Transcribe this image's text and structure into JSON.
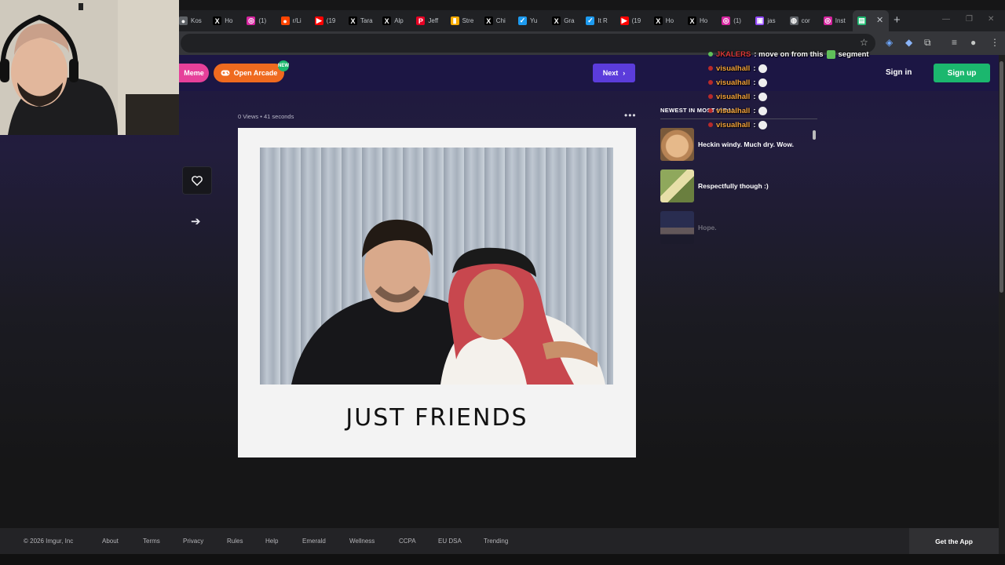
{
  "browser": {
    "tabs": [
      {
        "label": "Kos",
        "icon": "generic-site-icon",
        "color": "#5f6368"
      },
      {
        "label": "Ho",
        "icon": "x-icon",
        "color": "#000000"
      },
      {
        "label": "(1)",
        "icon": "instagram-icon",
        "color": "#d6249f"
      },
      {
        "label": "r/Li",
        "icon": "reddit-icon",
        "color": "#ff4500"
      },
      {
        "label": "(19",
        "icon": "youtube-icon",
        "color": "#ff0000"
      },
      {
        "label": "Tara",
        "icon": "x-icon",
        "color": "#000000"
      },
      {
        "label": "Alp",
        "icon": "x-icon",
        "color": "#000000"
      },
      {
        "label": "Jeff",
        "icon": "pin-icon",
        "color": "#e60023"
      },
      {
        "label": "Stre",
        "icon": "chart-icon",
        "color": "#f9ab00"
      },
      {
        "label": "Chi",
        "icon": "x-icon",
        "color": "#000000"
      },
      {
        "label": "Yu",
        "icon": "check-icon",
        "color": "#1d9bf0"
      },
      {
        "label": "Gra",
        "icon": "x-icon",
        "color": "#000000"
      },
      {
        "label": "It R",
        "icon": "check-icon",
        "color": "#1d9bf0"
      },
      {
        "label": "(19",
        "icon": "youtube-icon",
        "color": "#ff0000"
      },
      {
        "label": "Ho",
        "icon": "x-icon",
        "color": "#000000"
      },
      {
        "label": "Ho",
        "icon": "x-icon",
        "color": "#000000"
      },
      {
        "label": "(1)",
        "icon": "instagram-icon",
        "color": "#d6249f"
      },
      {
        "label": "jas",
        "icon": "twitch-icon",
        "color": "#9146ff"
      },
      {
        "label": "cor",
        "icon": "globe-icon",
        "color": "#5f6368"
      },
      {
        "label": "Inst",
        "icon": "instagram-icon",
        "color": "#d6249f"
      },
      {
        "label": "",
        "icon": "imgur-icon",
        "color": "#1bb76e"
      }
    ],
    "close_glyph": "✕",
    "new_tab_glyph": "+"
  },
  "header": {
    "meme_label": "Meme",
    "arcade_label": "Open Arcade",
    "arcade_badge": "NEW",
    "next_label": "Next",
    "signin_label": "Sign in",
    "signup_label": "Sign up",
    "accent_green": "#1bb76e",
    "accent_purple": "#5b3cdb"
  },
  "post": {
    "views": "0 Views",
    "separator": "•",
    "age": "41 seconds",
    "caption": "JUST FRIENDS"
  },
  "sidebar": {
    "title": "NEWEST IN MOST VIRAL",
    "items": [
      {
        "label": "Heckin windy. Much dry. Wow."
      },
      {
        "label": "Respectfully though :)"
      },
      {
        "label": "Hope."
      }
    ]
  },
  "footer": {
    "copyright": "© 2026 Imgur, Inc",
    "links": [
      "About",
      "Terms",
      "Privacy",
      "Rules",
      "Help",
      "Emerald",
      "Wellness",
      "CCPA",
      "EU DSA",
      "Trending"
    ],
    "get_app": "Get the App"
  },
  "chat": {
    "first_user": "JKALERS",
    "first_msg": ": move on from this",
    "first_msg_end": "segment",
    "lines": [
      {
        "user": "visualhall",
        "msg": ":"
      },
      {
        "user": "visualhall",
        "msg": ":"
      },
      {
        "user": "visualhall",
        "msg": ":"
      },
      {
        "user": "visualhall",
        "msg": ":"
      },
      {
        "user": "visualhall",
        "msg": ":"
      }
    ]
  }
}
